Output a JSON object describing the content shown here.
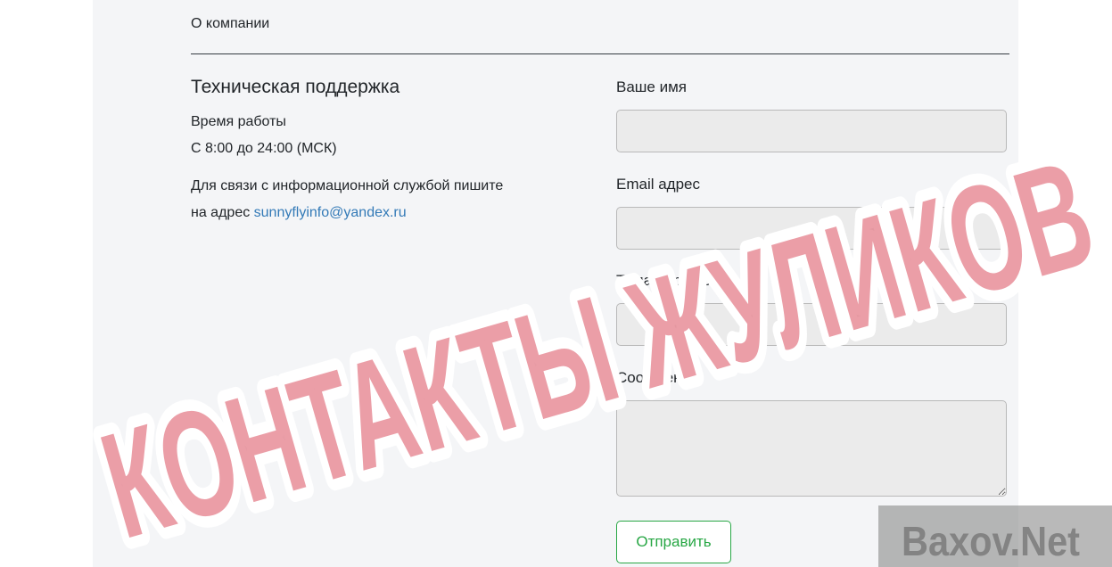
{
  "nav": {
    "about_label": "О компании"
  },
  "support": {
    "title": "Техническая поддержка",
    "hours_label": "Время работы",
    "hours_value": "С 8:00 до 24:00 (МСК)",
    "contact_text_1": "Для связи с информационной службой пишите",
    "contact_text_2": "на адрес ",
    "email": "sunnyflyinfo@yandex.ru"
  },
  "form": {
    "name_label": "Ваше имя",
    "name_value": "",
    "email_label": "Email адрес",
    "email_value": "",
    "subject_label": "Тема обращения",
    "subject_value": "",
    "message_label": "Сообщение",
    "message_value": "",
    "submit_label": "Отправить"
  },
  "overlay": {
    "stamp_text": "КОНТАКТЫ ЖУЛИКОВ",
    "stamp_color": "#e06a78",
    "watermark_text": "Baxov.Net"
  },
  "colors": {
    "page_background": "#f4f5f7",
    "link": "#337ab7",
    "submit_accent": "#28a745"
  }
}
